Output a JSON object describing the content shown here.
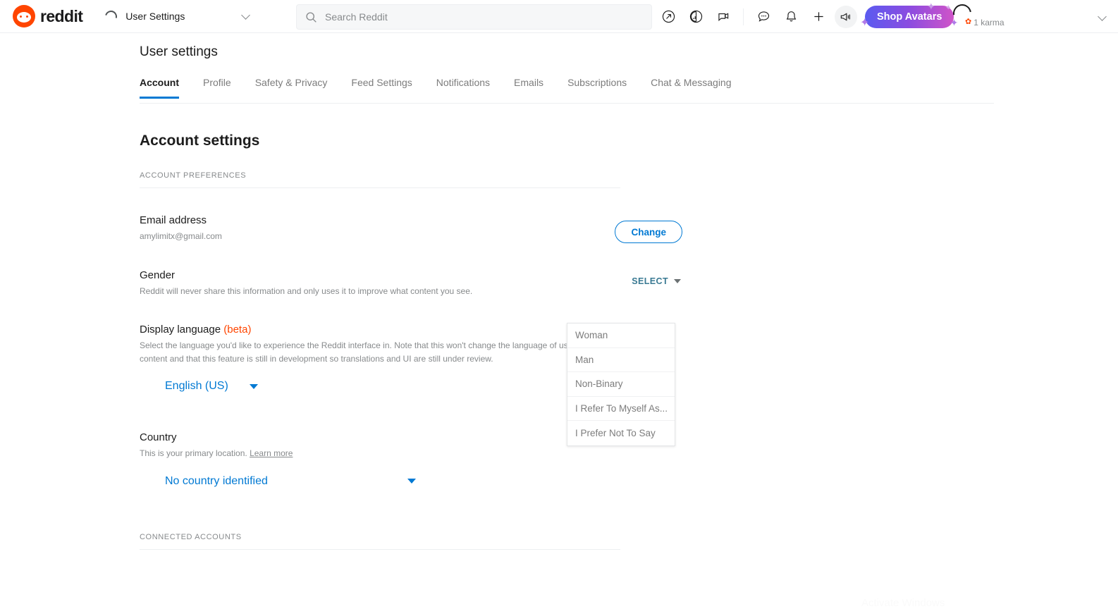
{
  "nav": {
    "brand_label": "reddit",
    "dropdown_label": "User Settings",
    "spinner_icon": "loading-spinner-icon",
    "search": {
      "placeholder": "Search Reddit",
      "icon": "search-icon"
    },
    "icons": [
      {
        "name": "popular-icon",
        "glyph": "↗"
      },
      {
        "name": "trending-icon",
        "glyph": "◔"
      },
      {
        "name": "chat-rooms-icon",
        "glyph": "🖵"
      },
      {
        "name": "messages-icon",
        "glyph": "💬"
      },
      {
        "name": "notifications-bell-icon",
        "glyph": "🔔"
      },
      {
        "name": "create-post-plus-icon",
        "glyph": "+"
      },
      {
        "name": "advertise-megaphone-icon",
        "glyph": "📢"
      }
    ],
    "shop_avatars_label": "Shop Avatars",
    "karma_value": "1 karma",
    "karma_icon": "karma-badge-icon"
  },
  "page": {
    "title": "User settings",
    "section_title": "Account settings"
  },
  "tabs": [
    {
      "label": "Account",
      "active": true
    },
    {
      "label": "Profile",
      "active": false
    },
    {
      "label": "Safety & Privacy",
      "active": false
    },
    {
      "label": "Feed Settings",
      "active": false
    },
    {
      "label": "Notifications",
      "active": false
    },
    {
      "label": "Emails",
      "active": false
    },
    {
      "label": "Subscriptions",
      "active": false
    },
    {
      "label": "Chat & Messaging",
      "active": false
    }
  ],
  "account_preferences": {
    "group_header": "ACCOUNT PREFERENCES",
    "email": {
      "title": "Email address",
      "value": "amylimitx@gmail.com",
      "button_label": "Change"
    },
    "gender": {
      "title": "Gender",
      "description": "Reddit will never share this information and only uses it to improve what content you see.",
      "select_label": "SELECT",
      "menu_open": true,
      "options": [
        "Woman",
        "Man",
        "Non-Binary",
        "I Refer To Myself As...",
        "I Prefer Not To Say"
      ]
    },
    "display_language": {
      "title": "Display language",
      "beta_label": "(beta)",
      "description": "Select the language you'd like to experience the Reddit interface in. Note that this won't change the language of user-generated content and that this feature is still in development so translations and UI are still under review.",
      "value": "English (US)"
    },
    "country": {
      "title": "Country",
      "description": "This is your primary location.",
      "learn_more_label": "Learn more",
      "value": "No country identified"
    }
  },
  "connected_accounts": {
    "group_header": "CONNECTED ACCOUNTS"
  },
  "watermark": {
    "text": "Activate Windows"
  },
  "colors": {
    "brand_orange": "#ff4500",
    "link_blue": "#0079d3",
    "select_teal": "#3a7a93",
    "muted_gray": "#878a8c"
  }
}
